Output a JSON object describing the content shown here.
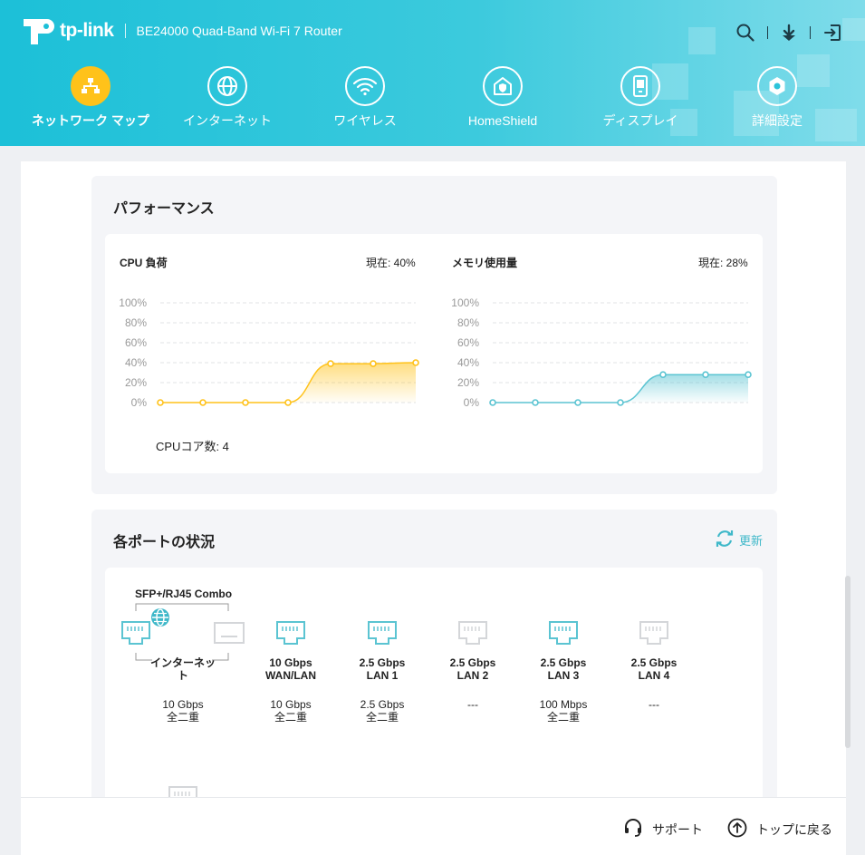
{
  "header": {
    "brand": "tp-link",
    "model": "BE24000 Quad-Band Wi-Fi 7 Router"
  },
  "nav": {
    "items": [
      {
        "label": "ネットワーク マップ",
        "icon": "network-map-icon",
        "active": true
      },
      {
        "label": "インターネット",
        "icon": "globe-icon",
        "active": false
      },
      {
        "label": "ワイヤレス",
        "icon": "wifi-icon",
        "active": false
      },
      {
        "label": "HomeShield",
        "icon": "home-shield-icon",
        "active": false
      },
      {
        "label": "ディスプレイ",
        "icon": "display-icon",
        "active": false
      },
      {
        "label": "詳細設定",
        "icon": "gear-icon",
        "active": false
      }
    ]
  },
  "performance": {
    "title": "パフォーマンス",
    "cpu": {
      "label": "CPU 負荷",
      "current": "現在: 40%",
      "cores": "CPUコア数: 4",
      "color": "#ffc21a"
    },
    "memory": {
      "label": "メモリ使用量",
      "current": "現在: 28%",
      "color": "#5bc4d2"
    }
  },
  "chart_data": [
    {
      "type": "area",
      "title": "CPU 負荷",
      "y_ticks": [
        "100%",
        "80%",
        "60%",
        "40%",
        "20%",
        "0%"
      ],
      "ylim": [
        0,
        100
      ],
      "values": [
        0,
        0,
        0,
        0,
        39,
        39,
        40
      ],
      "grid": true
    },
    {
      "type": "area",
      "title": "メモリ使用量",
      "y_ticks": [
        "100%",
        "80%",
        "60%",
        "40%",
        "20%",
        "0%"
      ],
      "ylim": [
        0,
        100
      ],
      "values": [
        0,
        0,
        0,
        0,
        28,
        28,
        28
      ],
      "grid": true
    }
  ],
  "ports": {
    "title": "各ポートの状況",
    "refresh_label": "更新",
    "combo_label": "SFP+/RJ45 Combo",
    "items": [
      {
        "name": "インターネット",
        "speed": "",
        "status_speed": "10 Gbps",
        "status_duplex": "全二重",
        "active": true
      },
      {
        "name": "WAN/LAN",
        "speed": "10 Gbps",
        "status_speed": "10 Gbps",
        "status_duplex": "全二重",
        "active": true
      },
      {
        "name": "LAN 1",
        "speed": "2.5 Gbps",
        "status_speed": "2.5 Gbps",
        "status_duplex": "全二重",
        "active": true
      },
      {
        "name": "LAN 2",
        "speed": "2.5 Gbps",
        "status_speed": "---",
        "status_duplex": "",
        "active": false
      },
      {
        "name": "LAN 3",
        "speed": "2.5 Gbps",
        "status_speed": "100 Mbps",
        "status_duplex": "全二重",
        "active": true
      },
      {
        "name": "LAN 4",
        "speed": "2.5 Gbps",
        "status_speed": "---",
        "status_duplex": "",
        "active": false
      }
    ]
  },
  "footer": {
    "support": "サポート",
    "back_to_top": "トップに戻る"
  },
  "colors": {
    "header": "#1cc0d8",
    "accent": "#ffc21a",
    "port_active": "#5bc4d2",
    "port_inactive": "#d4d6d9"
  }
}
